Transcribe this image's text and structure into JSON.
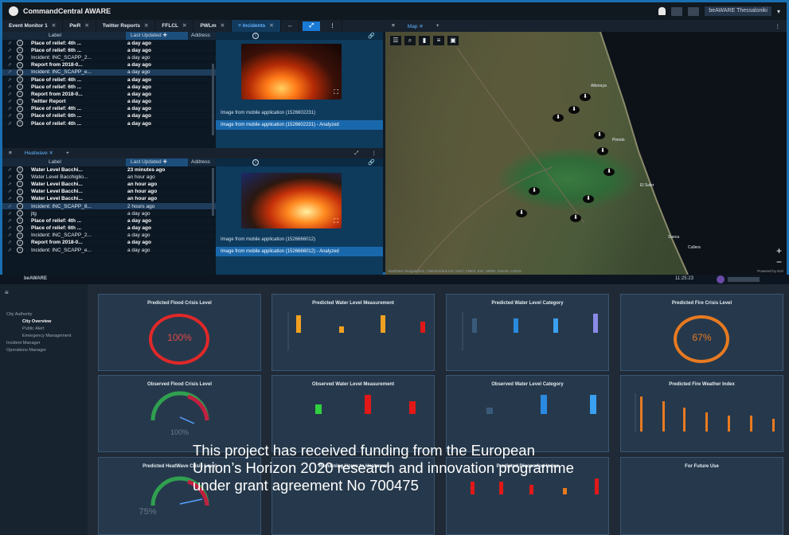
{
  "app": {
    "title": "CommandCentral AWARE",
    "user_label": "beAWARE Thessaloniki",
    "tabs": [
      {
        "label": "Event Monitor 1"
      },
      {
        "label": "PwR"
      },
      {
        "label": "Twitter Reports"
      },
      {
        "label": "FFLCL"
      },
      {
        "label": "PWLm"
      },
      {
        "label": "Incidents",
        "active": true
      }
    ]
  },
  "incidents_table": {
    "columns": [
      "Label",
      "Last Updated",
      "Address"
    ],
    "rows": [
      {
        "label": "Place of relief: 4th ...",
        "updated": "a day ago",
        "bold": true
      },
      {
        "label": "Place of relief: 6th ...",
        "updated": "a day ago",
        "bold": true
      },
      {
        "label": "Incident: INC_SCAPP_2...",
        "updated": "a day ago",
        "bold": false
      },
      {
        "label": "Report from 2018-0...",
        "updated": "a day ago",
        "bold": true
      },
      {
        "label": "Incident: INC_SCAPP_e...",
        "updated": "a day ago",
        "bold": false,
        "selected": true
      },
      {
        "label": "Place of relief: 4th ...",
        "updated": "a day ago",
        "bold": true
      },
      {
        "label": "Place of relief: 6th ...",
        "updated": "a day ago",
        "bold": true
      },
      {
        "label": "Report from 2018-0...",
        "updated": "a day ago",
        "bold": true
      },
      {
        "label": "Twitter Report",
        "updated": "a day ago",
        "bold": true
      },
      {
        "label": "Place of relief: 4th ...",
        "updated": "a day ago",
        "bold": true
      },
      {
        "label": "Place of relief: 6th ...",
        "updated": "a day ago",
        "bold": true
      },
      {
        "label": "Place of relief: 4th ...",
        "updated": "a day ago",
        "bold": true
      }
    ]
  },
  "incidents_images": {
    "line1": "Image from mobile application (1526602231)",
    "line2": "Image from mobile application (1526602231) - Analyzed"
  },
  "second_tab": {
    "label": "Heatwave"
  },
  "waterlevel_table": {
    "columns": [
      "Label",
      "Last Updated",
      "Address"
    ],
    "rows": [
      {
        "label": "Water Level Bacchi...",
        "updated": "23 minutes ago",
        "bold": true
      },
      {
        "label": "Water Level Bacchiglio...",
        "updated": "an hour ago",
        "bold": false
      },
      {
        "label": "Water Level Bacchi...",
        "updated": "an hour ago",
        "bold": true
      },
      {
        "label": "Water Level Bacchi...",
        "updated": "an hour ago",
        "bold": true
      },
      {
        "label": "Water Level Bacchi...",
        "updated": "an hour ago",
        "bold": true
      },
      {
        "label": "Incident: INC_SCAPP_8...",
        "updated": "2 hours ago",
        "bold": false,
        "selected": true
      },
      {
        "label": "jtg",
        "updated": "a day ago",
        "bold": false
      },
      {
        "label": "Place of relief: 4th ...",
        "updated": "a day ago",
        "bold": true
      },
      {
        "label": "Place of relief: 6th ...",
        "updated": "a day ago",
        "bold": true
      },
      {
        "label": "Incident: INC_SCAPP_2...",
        "updated": "a day ago",
        "bold": false
      },
      {
        "label": "Report from 2018-0...",
        "updated": "a day ago",
        "bold": true
      },
      {
        "label": "Incident: INC_SCAPP_e...",
        "updated": "a day ago",
        "bold": false
      }
    ]
  },
  "waterlevel_images": {
    "line1": "Image from mobile application (1526666012)",
    "line2": "Image from mobile application (1526666012) - Analyzed"
  },
  "map": {
    "tab_label": "Map",
    "attribution": "Earthstar Geographics, CNES/Airbus DS | Esri | CNES, Esri, HERE, Garmin, USGS",
    "powered": "Powered by Esri",
    "towns": [
      "Alboraya",
      "Pinedo",
      "El Saler",
      "Sueca",
      "Cullera"
    ]
  },
  "dashboard": {
    "brand": "beAWARE",
    "time": "11:25:23",
    "nav": [
      {
        "label": "City Authority",
        "level": 1
      },
      {
        "label": "City Overview",
        "level": 2,
        "active": true
      },
      {
        "label": "Public Alert",
        "level": 2
      },
      {
        "label": "Emergency Management",
        "level": 2
      },
      {
        "label": "Incident Manager",
        "level": 1
      },
      {
        "label": "Operations Manager",
        "level": 1
      }
    ],
    "cards": [
      {
        "title": "Predicted Flood Crisis Level",
        "value": "100%"
      },
      {
        "title": "Predicted Water Level Measurement"
      },
      {
        "title": "Predicted Water Level Category"
      },
      {
        "title": "Predicted Fire Crisis Level",
        "value": "67%"
      },
      {
        "title": "Observed Flood Crisis Level",
        "value": "100%"
      },
      {
        "title": "Observed Water Level Measurement"
      },
      {
        "title": "Observed Water Level Category"
      },
      {
        "title": "Predicted Fire Weather Index"
      },
      {
        "title": "Predicted HeatWave Crisis Level",
        "value": "75%"
      },
      {
        "title": "Remaining Hours to Heatwave"
      },
      {
        "title": "Predicted Discomfort Index"
      },
      {
        "title": "For Future Use"
      }
    ]
  },
  "funding_text": {
    "line1": "This project has received funding from the European",
    "line2": "Union’s Horizon 2020 research and innovation programme",
    "line3": "under grant agreement No 700475"
  },
  "colors": {
    "accent": "#1a7ad6",
    "gauge_red": "#e02828",
    "gauge_orange": "#e87a20",
    "bar_orange": "#f0a020",
    "bar_red": "#e01818",
    "bar_blue": "#2a8ae0",
    "bar_green": "#30d040",
    "bar_violet": "#8a8ae8"
  }
}
